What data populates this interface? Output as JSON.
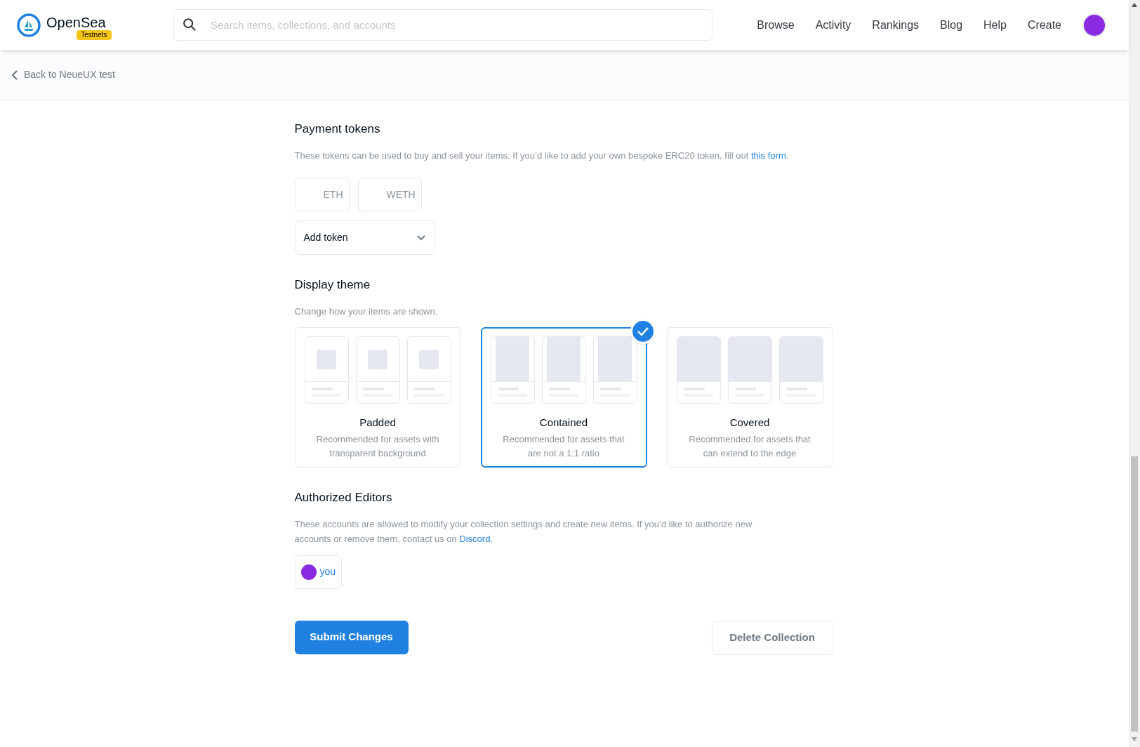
{
  "header": {
    "logo_text": "OpenSea",
    "badge": "Testnets",
    "search": {
      "placeholder": "Search items, collections, and accounts"
    },
    "nav": [
      "Browse",
      "Activity",
      "Rankings",
      "Blog",
      "Help",
      "Create"
    ]
  },
  "back_link": "Back to NeueUX test",
  "payment_tokens": {
    "title": "Payment tokens",
    "description": "These tokens can be used to buy and sell your items. If you’d like to add your own bespoke ERC20 token, fill out ",
    "link": "this form",
    "after_link": ".",
    "tokens": [
      "ETH",
      "WETH"
    ],
    "add_token": "Add token"
  },
  "display_theme": {
    "title": "Display theme",
    "description": "Change how your items are shown.",
    "themes": [
      {
        "kind": "padded",
        "name": "Padded",
        "description": "Recommended for assets with transparent background",
        "selected": false
      },
      {
        "kind": "contained",
        "name": "Contained",
        "description": "Recommended for assets that are not a 1:1 ratio",
        "selected": true
      },
      {
        "kind": "covered",
        "name": "Covered",
        "description": "Recommended for assets that can extend to the edge",
        "selected": false
      }
    ]
  },
  "authorized_editors": {
    "title": "Authorized Editors",
    "description": "These accounts are allowed to modify your collection settings and create new items. If you’d like to authorize new accounts or remove them, contact us on ",
    "link": "Discord",
    "after_link": ".",
    "editors": [
      "you"
    ]
  },
  "buttons": {
    "submit": "Submit Changes",
    "delete": "Delete Collection"
  }
}
